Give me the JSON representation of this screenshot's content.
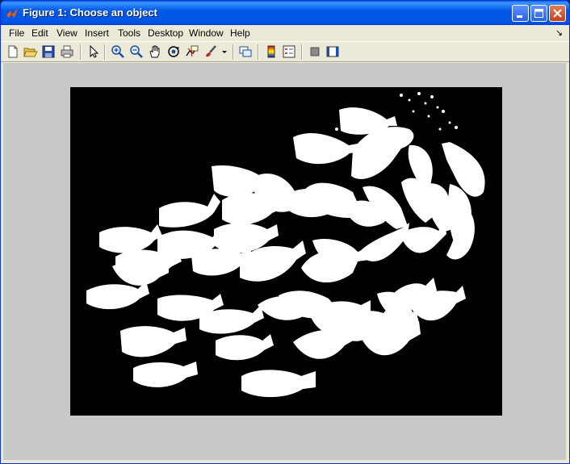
{
  "window": {
    "title": "Figure 1: Choose an object"
  },
  "menu": {
    "items": [
      {
        "label": "File"
      },
      {
        "label": "Edit"
      },
      {
        "label": "View"
      },
      {
        "label": "Insert"
      },
      {
        "label": "Tools"
      },
      {
        "label": "Desktop"
      },
      {
        "label": "Window"
      },
      {
        "label": "Help"
      }
    ],
    "dock_arrow": "↘"
  },
  "toolbar": {
    "tools": [
      "new-figure",
      "open-file",
      "save",
      "print",
      "edit-plot-arrow",
      "zoom-in",
      "zoom-out",
      "pan",
      "rotate-3d",
      "data-cursor",
      "brush",
      "brush-dropdown",
      "link-plot",
      "colorbar",
      "legend",
      "hide-plot-tools",
      "show-plot-tools"
    ]
  },
  "figure": {
    "background": "#c8c8c8",
    "image_background": "#000000",
    "foreground": "#ffffff",
    "content": "binary segmented image of white fish-shaped blobs"
  }
}
